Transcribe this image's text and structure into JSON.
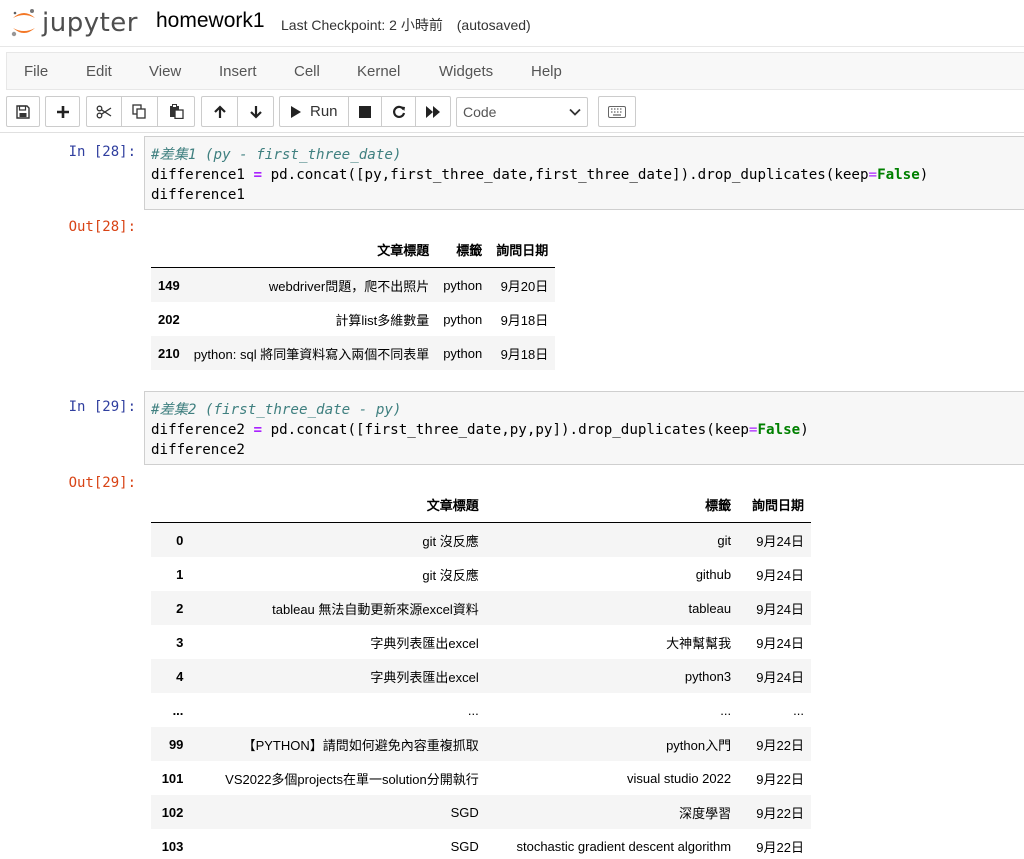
{
  "header": {
    "logo_text": "jupyter",
    "notebook_name": "homework1",
    "checkpoint": "Last Checkpoint: 2 小時前",
    "autosave": "(autosaved)"
  },
  "menu": [
    "File",
    "Edit",
    "View",
    "Insert",
    "Cell",
    "Kernel",
    "Widgets",
    "Help"
  ],
  "toolbar": {
    "run_label": "Run",
    "cell_type": "Code"
  },
  "cells": [
    {
      "in_prompt": "In [28]:",
      "comment": "#差集1 (py - first_three_date)",
      "line2_a": "difference1 ",
      "line2_eq": "=",
      "line2_b": " pd.concat([py,first_three_date,first_three_date]).drop_duplicates(keep",
      "line2_eq2": "=",
      "line2_kw": "False",
      "line2_end": ")",
      "line3": "difference1",
      "out_prompt": "Out[28]:",
      "table": {
        "columns": [
          "文章標題",
          "標籤",
          "詢問日期"
        ],
        "rows": [
          {
            "index": "149",
            "cells": [
              "webdriver問題，爬不出照片",
              "python",
              "9月20日"
            ]
          },
          {
            "index": "202",
            "cells": [
              "計算list多維數量",
              "python",
              "9月18日"
            ]
          },
          {
            "index": "210",
            "cells": [
              "python: sql 將同筆資料寫入兩個不同表單",
              "python",
              "9月18日"
            ]
          }
        ]
      }
    },
    {
      "in_prompt": "In [29]:",
      "comment": "#差集2 (first_three_date - py)",
      "line2_a": "difference2 ",
      "line2_eq": "=",
      "line2_b": " pd.concat([first_three_date,py,py]).drop_duplicates(keep",
      "line2_eq2": "=",
      "line2_kw": "False",
      "line2_end": ")",
      "line3": "difference2",
      "out_prompt": "Out[29]:",
      "table": {
        "columns": [
          "文章標題",
          "標籤",
          "詢問日期"
        ],
        "rows": [
          {
            "index": "0",
            "cells": [
              "git 沒反應",
              "git",
              "9月24日"
            ]
          },
          {
            "index": "1",
            "cells": [
              "git 沒反應",
              "github",
              "9月24日"
            ]
          },
          {
            "index": "2",
            "cells": [
              "tableau 無法自動更新來源excel資料",
              "tableau",
              "9月24日"
            ]
          },
          {
            "index": "3",
            "cells": [
              "字典列表匯出excel",
              "大神幫幫我",
              "9月24日"
            ]
          },
          {
            "index": "4",
            "cells": [
              "字典列表匯出excel",
              "python3",
              "9月24日"
            ]
          },
          {
            "index": "...",
            "cells": [
              "...",
              "...",
              "..."
            ]
          },
          {
            "index": "99",
            "cells": [
              "【PYTHON】請問如何避免內容重複抓取",
              "python入門",
              "9月22日"
            ]
          },
          {
            "index": "101",
            "cells": [
              "VS2022多個projects在單一solution分開執行",
              "visual studio 2022",
              "9月22日"
            ]
          },
          {
            "index": "102",
            "cells": [
              "SGD",
              "深度學習",
              "9月22日"
            ]
          },
          {
            "index": "103",
            "cells": [
              "SGD",
              "stochastic gradient descent algorithm",
              "9月22日"
            ]
          }
        ]
      }
    }
  ]
}
